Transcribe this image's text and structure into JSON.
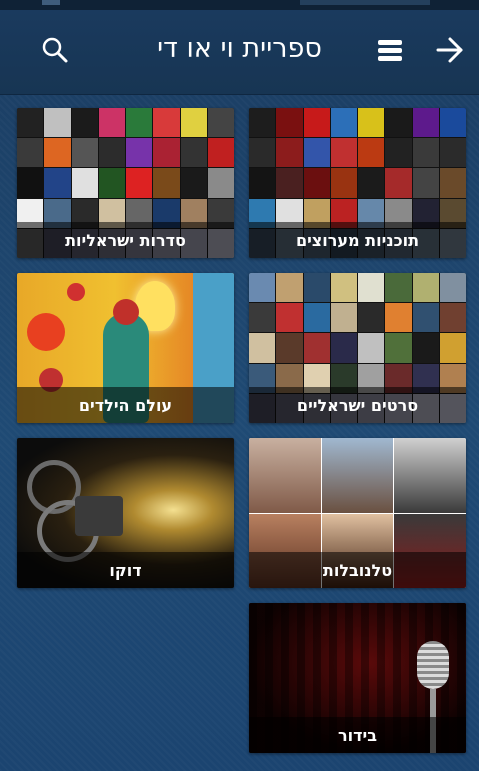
{
  "header": {
    "title": "ספריית וי או די"
  },
  "icons": {
    "search": "search-icon",
    "menu": "menu-icon",
    "back": "arrow-right-icon"
  },
  "categories": [
    {
      "label": "תוכניות מערוצים",
      "icon": "tv-channels-mosaic-image"
    },
    {
      "label": "סדרות ישראליות",
      "icon": "israeli-series-mosaic-image"
    },
    {
      "label": "סרטים ישראליים",
      "icon": "israeli-movies-mosaic-image"
    },
    {
      "label": "עולם הילדים",
      "icon": "kids-world-image"
    },
    {
      "label": "טלנובלות",
      "icon": "telenovelas-image"
    },
    {
      "label": "דוקו",
      "icon": "documentary-projector-image"
    },
    {
      "label": "בידור",
      "icon": "entertainment-microphone-image"
    }
  ],
  "colors": {
    "background": "#1f4a74",
    "header": "#173553",
    "label_overlay": "rgba(0,0,0,0.55)",
    "text": "#ffffff"
  }
}
